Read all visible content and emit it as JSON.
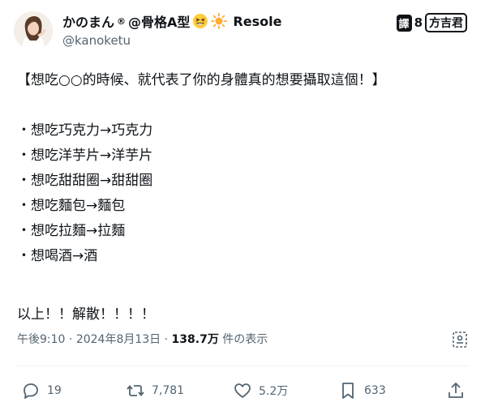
{
  "author": {
    "display_name": "かのまん",
    "registered_mark": "®",
    "name_suffix": "@骨格A型",
    "brand": "Resole",
    "handle": "@kanoketu",
    "emojis": [
      "grinning-squinting-face",
      "sun"
    ]
  },
  "watermark": {
    "badge": "譯",
    "separator": "8",
    "name": "方吉君"
  },
  "post": {
    "title_line": "【想吃○○的時候、就代表了你的身體真的想要攝取這個！】",
    "items": [
      "・想吃巧克力→巧克力",
      "・想吃洋芋片→洋芋片",
      "・想吃甜甜圈→甜甜圈",
      "・想吃麵包→麵包",
      "・想吃拉麵→拉麵",
      "・想喝酒→酒"
    ],
    "closing": "以上！！解散！！！！"
  },
  "meta": {
    "time": "午後9:10",
    "separator": "·",
    "date": "2024年8月13日",
    "views_count": "138.7万",
    "views_label": "件の表示"
  },
  "actions": {
    "replies": "19",
    "reposts": "7,781",
    "likes": "5.2万",
    "bookmarks": "633"
  }
}
